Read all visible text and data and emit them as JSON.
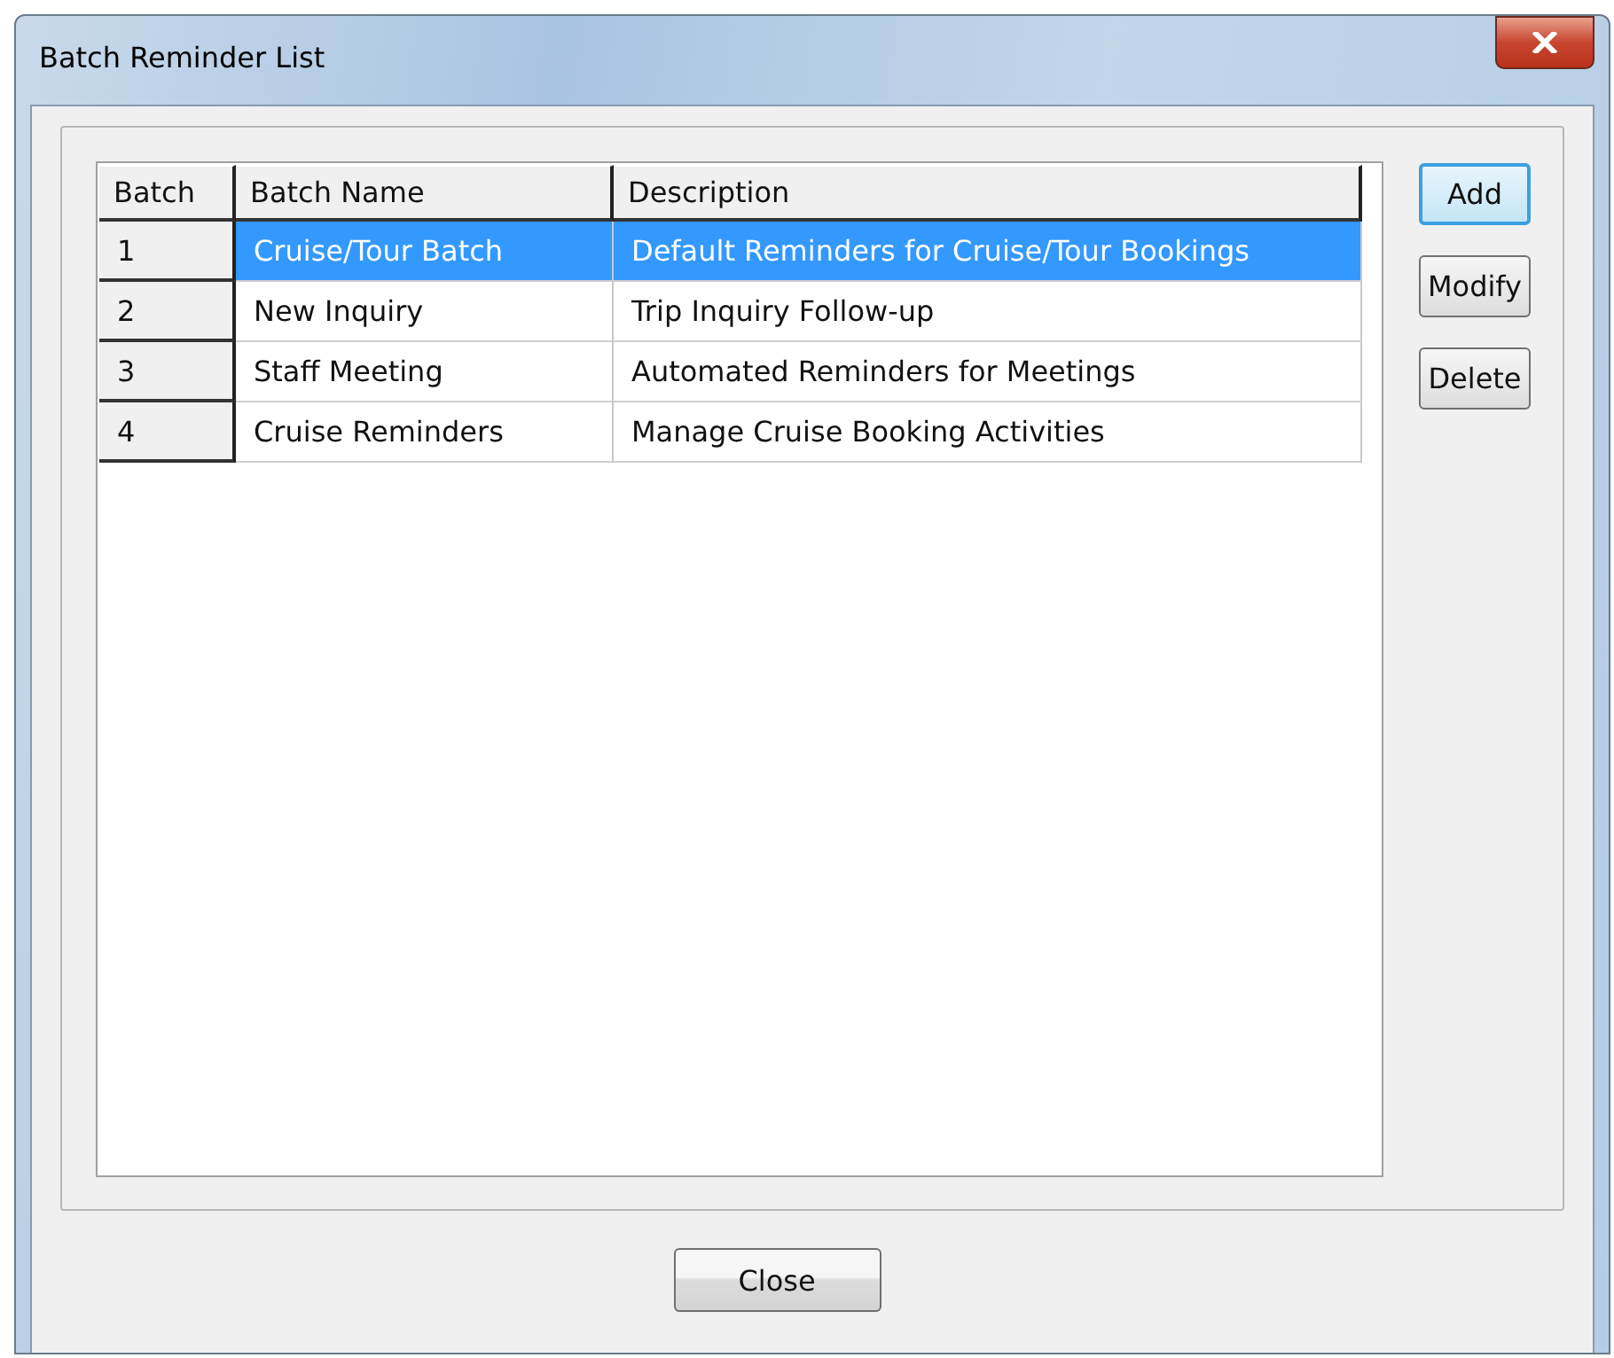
{
  "window": {
    "title": "Batch Reminder List"
  },
  "table": {
    "columns": [
      "Batch",
      "Batch Name",
      "Description"
    ],
    "rows": [
      {
        "cells": [
          "1",
          "Cruise/Tour Batch",
          "Default Reminders for Cruise/Tour Bookings"
        ],
        "selected": true
      },
      {
        "cells": [
          "2",
          "New Inquiry",
          "Trip Inquiry Follow-up"
        ],
        "selected": false
      },
      {
        "cells": [
          "3",
          "Staff Meeting",
          "Automated Reminders for Meetings"
        ],
        "selected": false
      },
      {
        "cells": [
          "4",
          "Cruise Reminders",
          "Manage Cruise Booking Activities"
        ],
        "selected": false
      }
    ]
  },
  "side_buttons": [
    {
      "label": "Add",
      "focused": true
    },
    {
      "label": "Modify",
      "focused": false
    },
    {
      "label": "Delete",
      "focused": false
    }
  ],
  "footer_button": {
    "label": "Close"
  }
}
